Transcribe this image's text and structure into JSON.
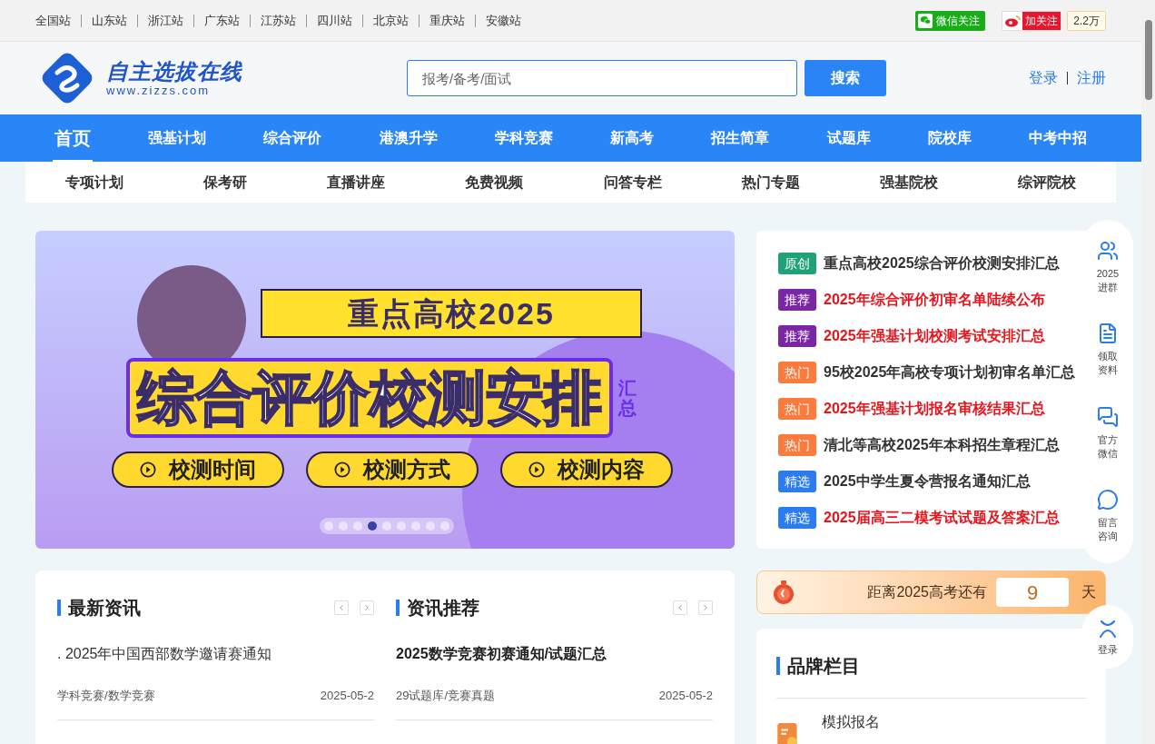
{
  "top_bar": {
    "stations": [
      "全国站",
      "山东站",
      "浙江站",
      "广东站",
      "江苏站",
      "四川站",
      "北京站",
      "重庆站",
      "安徽站"
    ],
    "wechat_follow": "微信关注",
    "weibo": {
      "label": "加关注",
      "count": "2.2万"
    }
  },
  "header": {
    "logo": {
      "title": "自主选拔在线",
      "url": "www.zizzs.com"
    },
    "search": {
      "placeholder": "报考/备考/面试",
      "button": "搜索"
    },
    "auth": [
      "登录",
      "注册"
    ]
  },
  "main_nav": [
    {
      "label": "首页",
      "selected": true
    },
    {
      "label": "强基计划",
      "selected": false
    },
    {
      "label": "综合评价",
      "selected": false
    },
    {
      "label": "港澳升学",
      "selected": false
    },
    {
      "label": "学科竞赛",
      "selected": false
    },
    {
      "label": "新高考",
      "selected": false
    },
    {
      "label": "招生简章",
      "selected": false
    },
    {
      "label": "试题库",
      "selected": false
    },
    {
      "label": "院校库",
      "selected": false
    },
    {
      "label": "中考中招",
      "selected": false
    }
  ],
  "sub_nav": [
    "专项计划",
    "保考研",
    "直播讲座",
    "免费视频",
    "问答专栏",
    "热门专题",
    "强基院校",
    "综评院校"
  ],
  "banner": {
    "ribbon": "重点高校2025",
    "headline": "综合评价校测安排",
    "side_tag": "汇总",
    "buttons": [
      "校测时间",
      "校测方式",
      "校测内容"
    ],
    "dots": [
      {
        "selected": false
      },
      {
        "selected": false
      },
      {
        "selected": false
      },
      {
        "selected": true
      },
      {
        "selected": false
      },
      {
        "selected": false
      },
      {
        "selected": false
      },
      {
        "selected": false
      },
      {
        "selected": false
      }
    ]
  },
  "headlines": [
    {
      "tag": "原创",
      "color": "#1fa27a",
      "title": "重点高校2025综合评价校测安排汇总",
      "emphasized": false
    },
    {
      "tag": "推荐",
      "color": "#7b27a5",
      "title": "2025年综合评价初审名单陆续公布",
      "emphasized": true
    },
    {
      "tag": "推荐",
      "color": "#7b27a5",
      "title": "2025年强基计划校测考试安排汇总",
      "emphasized": true
    },
    {
      "tag": "热门",
      "color": "#fb7a3c",
      "title": "95校2025年高校专项计划初审名单汇总",
      "emphasized": false
    },
    {
      "tag": "热门",
      "color": "#fb7a3c",
      "title": "2025年强基计划报名审核结果汇总",
      "emphasized": true
    },
    {
      "tag": "热门",
      "color": "#fb7a3c",
      "title": "清北等高校2025年本科招生章程汇总",
      "emphasized": false
    },
    {
      "tag": "精选",
      "color": "#2a7cf0",
      "title": "2025中学生夏令营报名通知汇总",
      "emphasized": false
    },
    {
      "tag": "精选",
      "color": "#2a7cf0",
      "title": "2025届高三二模考试试题及答案汇总",
      "emphasized": true
    }
  ],
  "float_bar": [
    {
      "kind": "group",
      "lines": [
        "2025",
        "进群"
      ]
    },
    {
      "kind": "document",
      "lines": [
        "领取",
        "资料"
      ]
    },
    {
      "kind": "wechat",
      "lines": [
        "官方",
        "微信"
      ]
    },
    {
      "kind": "chat",
      "lines": [
        "留言",
        "咨询"
      ]
    },
    {
      "kind": "login",
      "lines": [
        "登录"
      ]
    }
  ],
  "news_sections": [
    {
      "title": "最新资讯",
      "items": [
        {
          "title": ". 2025年中国西部数学邀请赛通知",
          "bold": false,
          "category": "学科竞赛/数学竞赛",
          "date": "2025-05-2"
        }
      ]
    },
    {
      "title": "资讯推荐",
      "items": [
        {
          "title": "2025数学竞赛初赛通知/试题汇总",
          "bold": true,
          "category": "29试题库/竞赛真题",
          "date": "2025-05-2"
        }
      ]
    }
  ],
  "countdown": {
    "label": "距离2025高考还有",
    "days": "9",
    "unit": "天"
  },
  "brand": {
    "title": "品牌栏目",
    "items": [
      {
        "title": "模拟报名"
      }
    ]
  }
}
